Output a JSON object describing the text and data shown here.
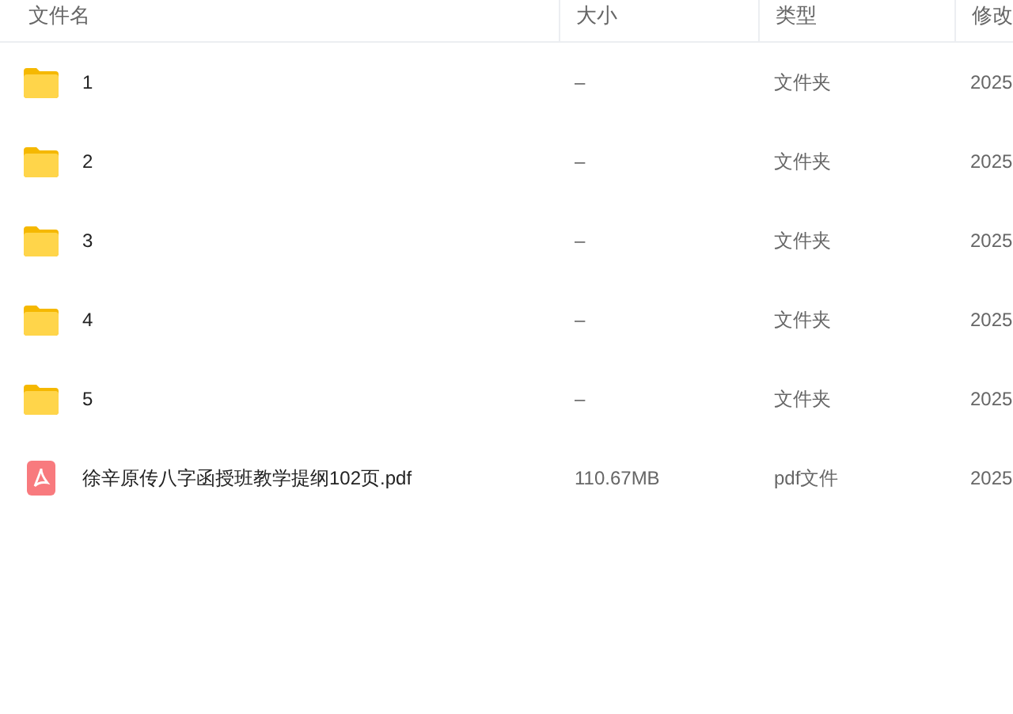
{
  "table": {
    "columns": [
      "文件名",
      "大小",
      "类型",
      "修改"
    ],
    "rows": [
      {
        "kind": "folder",
        "name": "1",
        "size": "–",
        "type": "文件夹",
        "modified": "2025"
      },
      {
        "kind": "folder",
        "name": "2",
        "size": "–",
        "type": "文件夹",
        "modified": "2025"
      },
      {
        "kind": "folder",
        "name": "3",
        "size": "–",
        "type": "文件夹",
        "modified": "2025"
      },
      {
        "kind": "folder",
        "name": "4",
        "size": "–",
        "type": "文件夹",
        "modified": "2025"
      },
      {
        "kind": "folder",
        "name": "5",
        "size": "–",
        "type": "文件夹",
        "modified": "2025"
      },
      {
        "kind": "pdf",
        "name": "徐辛原传八字函授班教学提纲102页.pdf",
        "size": "110.67MB",
        "type": "pdf文件",
        "modified": "2025"
      }
    ]
  }
}
